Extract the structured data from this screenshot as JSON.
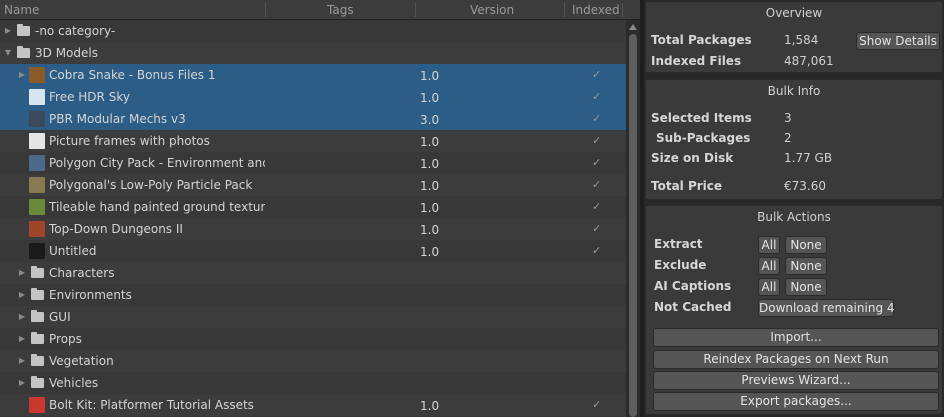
{
  "tree": {
    "columns": {
      "name": "Name",
      "tags": "Tags",
      "version": "Version",
      "indexed": "Indexed"
    },
    "check_glyph": "✓",
    "rows": [
      {
        "label": "-no category-",
        "kind": "folder",
        "level": 0,
        "expanded": false
      },
      {
        "label": "3D Models",
        "kind": "folder",
        "level": 0,
        "expanded": true
      },
      {
        "label": "Cobra Snake - Bonus Files 1",
        "kind": "package",
        "level": 1,
        "version": "1.0",
        "indexed": true,
        "selected": true,
        "has_arrow": true,
        "thumb": "#8a5a2a"
      },
      {
        "label": "Free HDR Sky",
        "kind": "package",
        "level": 1,
        "version": "1.0",
        "indexed": true,
        "selected": true,
        "thumb": "#d8e4f0"
      },
      {
        "label": "PBR Modular Mechs v3",
        "kind": "package",
        "level": 1,
        "version": "3.0",
        "indexed": true,
        "selected": true,
        "thumb": "#3a4a5a"
      },
      {
        "label": "Picture frames with photos",
        "kind": "package",
        "level": 1,
        "version": "1.0",
        "indexed": true,
        "thumb": "#e6e6e6"
      },
      {
        "label": "Polygon City Pack - Environment and I",
        "kind": "package",
        "level": 1,
        "version": "1.0",
        "indexed": true,
        "thumb": "#4b6a8a"
      },
      {
        "label": "Polygonal's Low-Poly Particle Pack",
        "kind": "package",
        "level": 1,
        "version": "1.0",
        "indexed": true,
        "thumb": "#8a7a52"
      },
      {
        "label": "Tileable hand painted ground texture p",
        "kind": "package",
        "level": 1,
        "version": "1.0",
        "indexed": true,
        "thumb": "#6a8a3a"
      },
      {
        "label": "Top-Down Dungeons II",
        "kind": "package",
        "level": 1,
        "version": "1.0",
        "indexed": true,
        "thumb": "#a0452a"
      },
      {
        "label": "Untitled",
        "kind": "package",
        "level": 1,
        "version": "1.0",
        "indexed": true,
        "thumb": "#1a1a1a"
      },
      {
        "label": "Characters",
        "kind": "folder",
        "level": 1,
        "expanded": false
      },
      {
        "label": "Environments",
        "kind": "folder",
        "level": 1,
        "expanded": false
      },
      {
        "label": "GUI",
        "kind": "folder",
        "level": 1,
        "expanded": false
      },
      {
        "label": "Props",
        "kind": "folder",
        "level": 1,
        "expanded": false
      },
      {
        "label": "Vegetation",
        "kind": "folder",
        "level": 1,
        "expanded": false
      },
      {
        "label": "Vehicles",
        "kind": "folder",
        "level": 1,
        "expanded": false
      },
      {
        "label": "Bolt Kit: Platformer Tutorial Assets",
        "kind": "package",
        "level": 1,
        "version": "1.0",
        "indexed": true,
        "thumb": "#c8382e"
      }
    ]
  },
  "overview": {
    "title": "Overview",
    "total_packages_label": "Total Packages",
    "total_packages_value": "1,584",
    "show_details_label": "Show Details",
    "indexed_files_label": "Indexed Files",
    "indexed_files_value": "487,061"
  },
  "bulk_info": {
    "title": "Bulk Info",
    "selected_items_label": "Selected Items",
    "selected_items_value": "3",
    "sub_packages_label": "Sub-Packages",
    "sub_packages_value": "2",
    "size_on_disk_label": "Size on Disk",
    "size_on_disk_value": "1.77 GB",
    "total_price_label": "Total Price",
    "total_price_value": "€73.60"
  },
  "bulk_actions": {
    "title": "Bulk Actions",
    "extract_label": "Extract",
    "exclude_label": "Exclude",
    "ai_captions_label": "AI Captions",
    "not_cached_label": "Not Cached",
    "all_label": "All",
    "none_label": "None",
    "download_remaining_label": "Download remaining 4",
    "import_label": "Import...",
    "reindex_label": "Reindex Packages on Next Run",
    "previews_wizard_label": "Previews Wizard...",
    "export_label": "Export packages..."
  },
  "colors": {
    "selection": "#2c5d87",
    "panel": "#383838",
    "row_alt": "#3c3c3c"
  }
}
